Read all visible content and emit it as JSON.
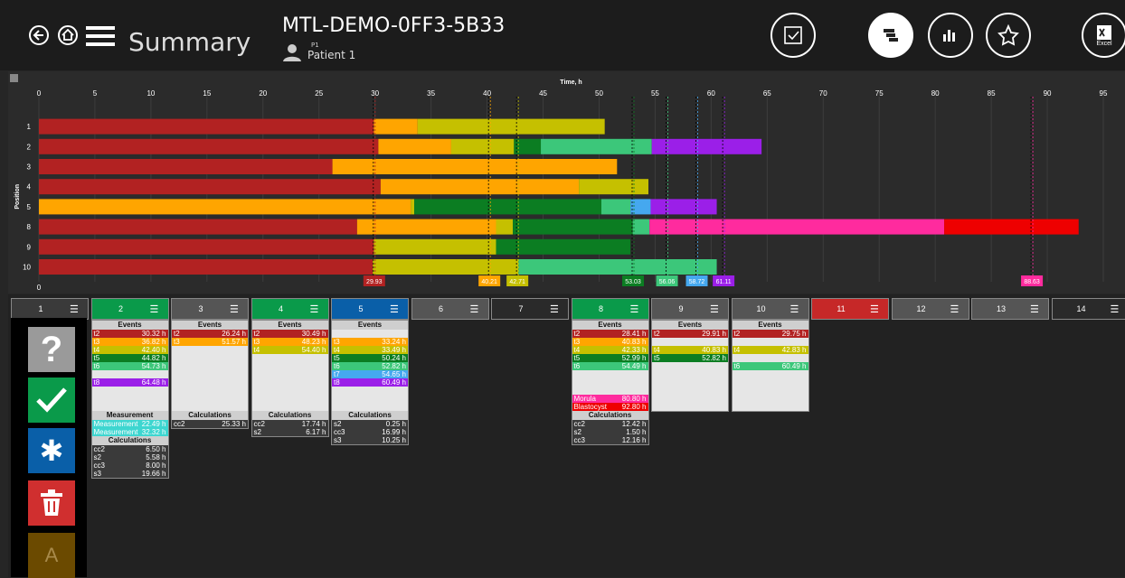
{
  "header": {
    "title": "Summary",
    "slide_id": "MTL-DEMO-0FF3-5B33",
    "patient_code": "P1",
    "patient_name": "Patient 1",
    "excel_label": "Excel"
  },
  "icons": {
    "back": "back-arrow-icon",
    "home": "home-icon",
    "menu": "hamburger-menu-icon",
    "checkbox": "checkbox-icon",
    "timeline": "timeline-icon",
    "stats": "bar-chart-icon",
    "star": "star-icon",
    "excel": "excel-icon"
  },
  "chart_data": {
    "type": "gantt",
    "xlabel": "Time, h",
    "ylabel": "Position",
    "xlim": [
      0,
      95
    ],
    "ticks": [
      0,
      5,
      10,
      15,
      20,
      25,
      30,
      35,
      40,
      45,
      50,
      55,
      60,
      65,
      70,
      75,
      80,
      85,
      90,
      95
    ],
    "colors": {
      "t0": "#b22222",
      "t2": "#ffa500",
      "t4": "#c5c000",
      "t5": "#0b7d22",
      "t6": "#3cc77a",
      "t7": "#45a8ef",
      "t8": "#9b1fe8",
      "morula": "#ff2b9e",
      "blast": "#ee0000"
    },
    "rows": [
      {
        "label": "1",
        "segments": [
          [
            0,
            29.9,
            "t0"
          ],
          [
            29.9,
            33.8,
            "t2"
          ],
          [
            33.8,
            50.5,
            "t4"
          ]
        ]
      },
      {
        "label": "2",
        "segments": [
          [
            0,
            30.3,
            "t0"
          ],
          [
            30.3,
            36.8,
            "t2"
          ],
          [
            36.8,
            42.4,
            "t4"
          ],
          [
            42.4,
            44.8,
            "t5"
          ],
          [
            44.8,
            54.7,
            "t6"
          ],
          [
            54.7,
            64.5,
            "t8"
          ]
        ]
      },
      {
        "label": "3",
        "segments": [
          [
            0,
            26.2,
            "t0"
          ],
          [
            26.2,
            51.6,
            "t2"
          ]
        ]
      },
      {
        "label": "4",
        "segments": [
          [
            0,
            30.5,
            "t0"
          ],
          [
            30.5,
            48.2,
            "t2"
          ],
          [
            48.2,
            54.4,
            "t4"
          ]
        ]
      },
      {
        "label": "5",
        "segments": [
          [
            0,
            33.2,
            "t2"
          ],
          [
            33.2,
            33.5,
            "t4"
          ],
          [
            33.5,
            50.2,
            "t5"
          ],
          [
            50.2,
            52.8,
            "t6"
          ],
          [
            52.8,
            54.6,
            "t7"
          ],
          [
            54.6,
            60.5,
            "t8"
          ]
        ]
      },
      {
        "label": "8",
        "segments": [
          [
            0,
            28.4,
            "t0"
          ],
          [
            28.4,
            40.8,
            "t2"
          ],
          [
            40.8,
            42.3,
            "t4"
          ],
          [
            42.3,
            53.0,
            "t5"
          ],
          [
            53.0,
            54.5,
            "t6"
          ],
          [
            54.5,
            80.8,
            "morula"
          ],
          [
            80.8,
            92.8,
            "blast"
          ]
        ]
      },
      {
        "label": "9",
        "segments": [
          [
            0,
            29.9,
            "t0"
          ],
          [
            29.9,
            40.8,
            "t4"
          ],
          [
            40.8,
            52.8,
            "t5"
          ]
        ]
      },
      {
        "label": "10",
        "segments": [
          [
            0,
            29.8,
            "t0"
          ],
          [
            29.8,
            42.8,
            "t4"
          ],
          [
            42.8,
            60.5,
            "t6"
          ]
        ]
      }
    ],
    "markers": [
      {
        "x": 29.93,
        "label": "29.93",
        "color": "#b22222"
      },
      {
        "x": 40.21,
        "label": "40.21",
        "color": "#ffa500"
      },
      {
        "x": 42.71,
        "label": "42.71",
        "color": "#c5c000"
      },
      {
        "x": 53.03,
        "label": "53.03",
        "color": "#0b7d22"
      },
      {
        "x": 56.06,
        "label": "56.06",
        "color": "#3cc77a"
      },
      {
        "x": 58.72,
        "label": "58.72",
        "color": "#45a8ef"
      },
      {
        "x": 61.11,
        "label": "61.11",
        "color": "#9b1fe8"
      },
      {
        "x": 88.63,
        "label": "88.63",
        "color": "#ff2b9e"
      }
    ]
  },
  "embryos": [
    {
      "num": "1",
      "color": "#3a3a3a"
    },
    {
      "num": "2",
      "color": "#0a9a4a"
    },
    {
      "num": "3",
      "color": "#555555"
    },
    {
      "num": "4",
      "color": "#0a9a4a"
    },
    {
      "num": "5",
      "color": "#0a5fa8"
    },
    {
      "num": "6",
      "color": "#555555"
    },
    {
      "num": "7",
      "color": "#2a2a2a"
    },
    {
      "num": "8",
      "color": "#0a9a4a"
    },
    {
      "num": "9",
      "color": "#555555"
    },
    {
      "num": "10",
      "color": "#555555"
    },
    {
      "num": "11",
      "color": "#c62828"
    },
    {
      "num": "12",
      "color": "#555555"
    },
    {
      "num": "13",
      "color": "#555555"
    },
    {
      "num": "14",
      "color": "#2a2a2a"
    }
  ],
  "panels": [
    {
      "col": 1,
      "events_title": "Events",
      "events": [
        [
          "t2",
          "30.32 h",
          "#b22222"
        ],
        [
          "t3",
          "36.82 h",
          "#ffa500"
        ],
        [
          "t4",
          "42.40 h",
          "#c5c000"
        ],
        [
          "t5",
          "44.82 h",
          "#0b7d22"
        ],
        [
          "t6",
          "54.73 h",
          "#3cc77a"
        ],
        [
          "",
          ""
        ],
        [
          "t8",
          "64.48 h",
          "#9b1fe8"
        ],
        [
          "",
          ""
        ],
        [
          "",
          ""
        ],
        [
          "",
          ""
        ]
      ],
      "meas_title": "Measurement",
      "measurements": [
        [
          "Measurement",
          "22.49 h"
        ],
        [
          "Measurement",
          "32.32 h"
        ]
      ],
      "calc_title": "Calculations",
      "calcs": [
        [
          "cc2",
          "6.50 h"
        ],
        [
          "s2",
          "5.58 h"
        ],
        [
          "cc3",
          "8.00 h"
        ],
        [
          "s3",
          "19.66 h"
        ]
      ]
    },
    {
      "col": 2,
      "events_title": "Events",
      "events": [
        [
          "t2",
          "26.24 h",
          "#b22222"
        ],
        [
          "t3",
          "51.57 h",
          "#ffa500"
        ],
        [
          "",
          ""
        ],
        [
          "",
          ""
        ],
        [
          "",
          ""
        ],
        [
          "",
          ""
        ],
        [
          "",
          ""
        ],
        [
          "",
          ""
        ],
        [
          "",
          ""
        ],
        [
          "",
          ""
        ]
      ],
      "calc_title": "Calculations",
      "calcs": [
        [
          "cc2",
          "25.33 h"
        ]
      ]
    },
    {
      "col": 3,
      "events_title": "Events",
      "events": [
        [
          "t2",
          "30.49 h",
          "#b22222"
        ],
        [
          "t3",
          "48.23 h",
          "#ffa500"
        ],
        [
          "t4",
          "54.40 h",
          "#c5c000"
        ],
        [
          "",
          ""
        ],
        [
          "",
          ""
        ],
        [
          "",
          ""
        ],
        [
          "",
          ""
        ],
        [
          "",
          ""
        ],
        [
          "",
          ""
        ],
        [
          "",
          ""
        ]
      ],
      "calc_title": "Calculations",
      "calcs": [
        [
          "cc2",
          "17.74 h"
        ],
        [
          "s2",
          "6.17 h"
        ]
      ]
    },
    {
      "col": 4,
      "events_title": "Events",
      "events": [
        [
          "",
          ""
        ],
        [
          "t3",
          "33.24 h",
          "#ffa500"
        ],
        [
          "t4",
          "33.49 h",
          "#c5c000"
        ],
        [
          "t5",
          "50.24 h",
          "#0b7d22"
        ],
        [
          "t6",
          "52.82 h",
          "#3cc77a"
        ],
        [
          "t7",
          "54.65 h",
          "#45a8ef"
        ],
        [
          "t8",
          "60.49 h",
          "#9b1fe8"
        ],
        [
          "",
          ""
        ],
        [
          "",
          ""
        ],
        [
          "",
          ""
        ]
      ],
      "calc_title": "Calculations",
      "calcs": [
        [
          "s2",
          "0.25 h"
        ],
        [
          "cc3",
          "16.99 h"
        ],
        [
          "s3",
          "10.25 h"
        ]
      ]
    },
    {
      "col": 7,
      "events_title": "Events",
      "events": [
        [
          "t2",
          "28.41 h",
          "#b22222"
        ],
        [
          "t3",
          "40.83 h",
          "#ffa500"
        ],
        [
          "t4",
          "42.33 h",
          "#c5c000"
        ],
        [
          "t5",
          "52.99 h",
          "#0b7d22"
        ],
        [
          "t6",
          "54.49 h",
          "#3cc77a"
        ],
        [
          "",
          ""
        ],
        [
          "",
          ""
        ],
        [
          "",
          ""
        ],
        [
          "Morula",
          "80.80 h",
          "#ff2b9e"
        ],
        [
          "Blastocyst",
          "92.80 h",
          "#ee0000"
        ]
      ],
      "calc_title": "Calculations",
      "calcs": [
        [
          "cc2",
          "12.42 h"
        ],
        [
          "s2",
          "1.50 h"
        ],
        [
          "cc3",
          "12.16 h"
        ]
      ]
    },
    {
      "col": 8,
      "events_title": "Events",
      "events": [
        [
          "t2",
          "29.91 h",
          "#b22222"
        ],
        [
          "",
          ""
        ],
        [
          "t4",
          "40.83 h",
          "#c5c000"
        ],
        [
          "t5",
          "52.82 h",
          "#0b7d22"
        ],
        [
          "",
          ""
        ],
        [
          "",
          ""
        ],
        [
          "",
          ""
        ],
        [
          "",
          ""
        ],
        [
          "",
          ""
        ],
        [
          "",
          ""
        ]
      ]
    },
    {
      "col": 9,
      "events_title": "Events",
      "events": [
        [
          "t2",
          "29.75 h",
          "#b22222"
        ],
        [
          "",
          ""
        ],
        [
          "t4",
          "42.83 h",
          "#c5c000"
        ],
        [
          "",
          ""
        ],
        [
          "t6",
          "60.49 h",
          "#3cc77a"
        ],
        [
          "",
          ""
        ],
        [
          "",
          ""
        ],
        [
          "",
          ""
        ],
        [
          "",
          ""
        ],
        [
          "",
          ""
        ]
      ]
    }
  ],
  "sidebar": {
    "help": "help-icon",
    "accept": "check-icon",
    "freeze": "snowflake-icon",
    "delete": "trash-icon",
    "annotate_label": "A"
  }
}
